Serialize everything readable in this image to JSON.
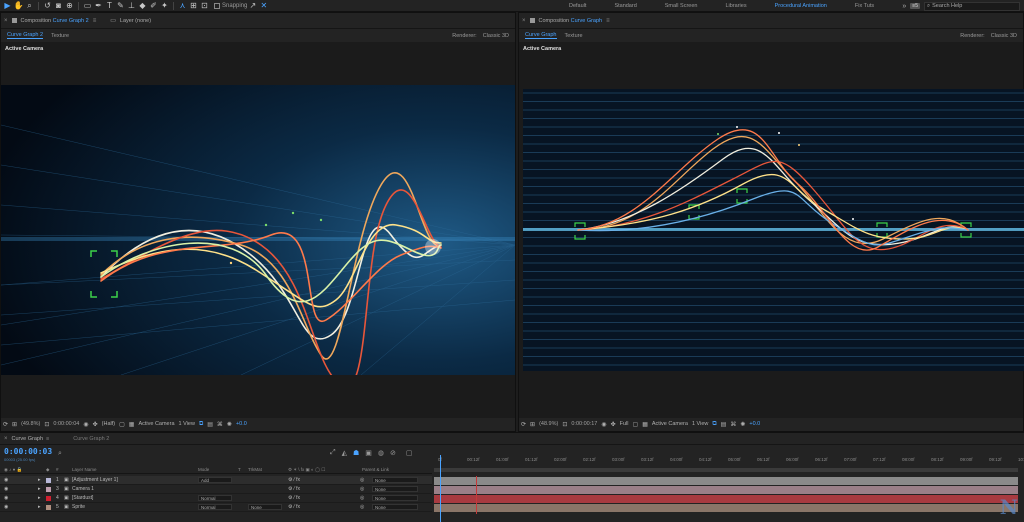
{
  "toolbar": {
    "tool_icons": [
      "selection-tool",
      "hand-tool",
      "zoom-tool",
      "rotate-tool",
      "camera-tool",
      "pan-behind-tool",
      "rectangle-tool",
      "pen-tool",
      "type-tool",
      "brush-tool",
      "clone-stamp-tool",
      "eraser-tool",
      "roto-brush-tool",
      "puppet-tool"
    ],
    "snapping_label": "Snapping",
    "workspaces": [
      "Default",
      "Standard",
      "Small Screen",
      "Libraries",
      "Procedural Animation",
      "Fix Tuts"
    ],
    "active_workspace": "Procedural Animation",
    "more_symbol": "»",
    "badge": "≡5",
    "search_placeholder": "Search Help"
  },
  "left_panel": {
    "close": "×",
    "title_prefix": "Composition",
    "title_comp": "Curve Graph 2",
    "menu": "≡",
    "layer_tab": "Layer (none)",
    "crumbs": [
      "Curve Graph 2",
      "Texture"
    ],
    "renderer_label": "Renderer:",
    "renderer_value": "Classic 3D",
    "active_camera": "Active Camera",
    "zoom": "(49.8%)",
    "timecode": "0:00:00:04",
    "resolution": "(Half)",
    "view": "Active Camera",
    "views": "1 View",
    "exposure": "+0.0"
  },
  "right_panel": {
    "close": "×",
    "title_prefix": "Composition",
    "title_comp": "Curve Graph",
    "menu": "≡",
    "crumbs": [
      "Curve Graph",
      "Texture"
    ],
    "renderer_label": "Renderer:",
    "renderer_value": "Classic 3D",
    "active_camera": "Active Camera",
    "zoom": "(48.9%)",
    "timecode": "0:00:00:17",
    "resolution": "Full",
    "view": "Active Camera",
    "views": "1 View",
    "exposure": "+0.0"
  },
  "timeline": {
    "tabs": [
      "Curve Graph",
      "Curve Graph 2"
    ],
    "timecode": "0:00:00:03",
    "frames": "00003 (25.00 fps)",
    "ruler_labels": [
      "0f",
      "00:12f",
      "01:00f",
      "01:12f",
      "02:00f",
      "02:12f",
      "03:00f",
      "03:12f",
      "04:00f",
      "04:12f",
      "05:00f",
      "05:12f",
      "06:00f",
      "06:12f",
      "07:00f",
      "07:12f",
      "08:00f",
      "08:12f",
      "09:00f",
      "09:12f",
      "10:0"
    ],
    "columns": {
      "layer_name": "Layer Name",
      "mode": "Mode",
      "t": "T",
      "trkmat": "TrkMat",
      "parent": "Parent & Link"
    },
    "layers": [
      {
        "num": "1",
        "name": "[Adjustment Layer 1]",
        "mode": "Add",
        "trkmat": "",
        "parent": "None",
        "color": "#b8b8d8",
        "bar": "#8a8a8a"
      },
      {
        "num": "3",
        "name": "Camera 1",
        "mode": "",
        "trkmat": "",
        "parent": "None",
        "color": "#c0a0b0",
        "bar": "#9a7f88"
      },
      {
        "num": "4",
        "name": "[Stardust]",
        "mode": "Normal",
        "trkmat": "",
        "parent": "None",
        "color": "#d02030",
        "bar": "#a83a40"
      },
      {
        "num": "5",
        "name": "Sprite",
        "mode": "Normal",
        "trkmat": "None",
        "parent": "None",
        "color": "#b09080",
        "bar": "#8a7568"
      }
    ]
  },
  "watermark": "N"
}
